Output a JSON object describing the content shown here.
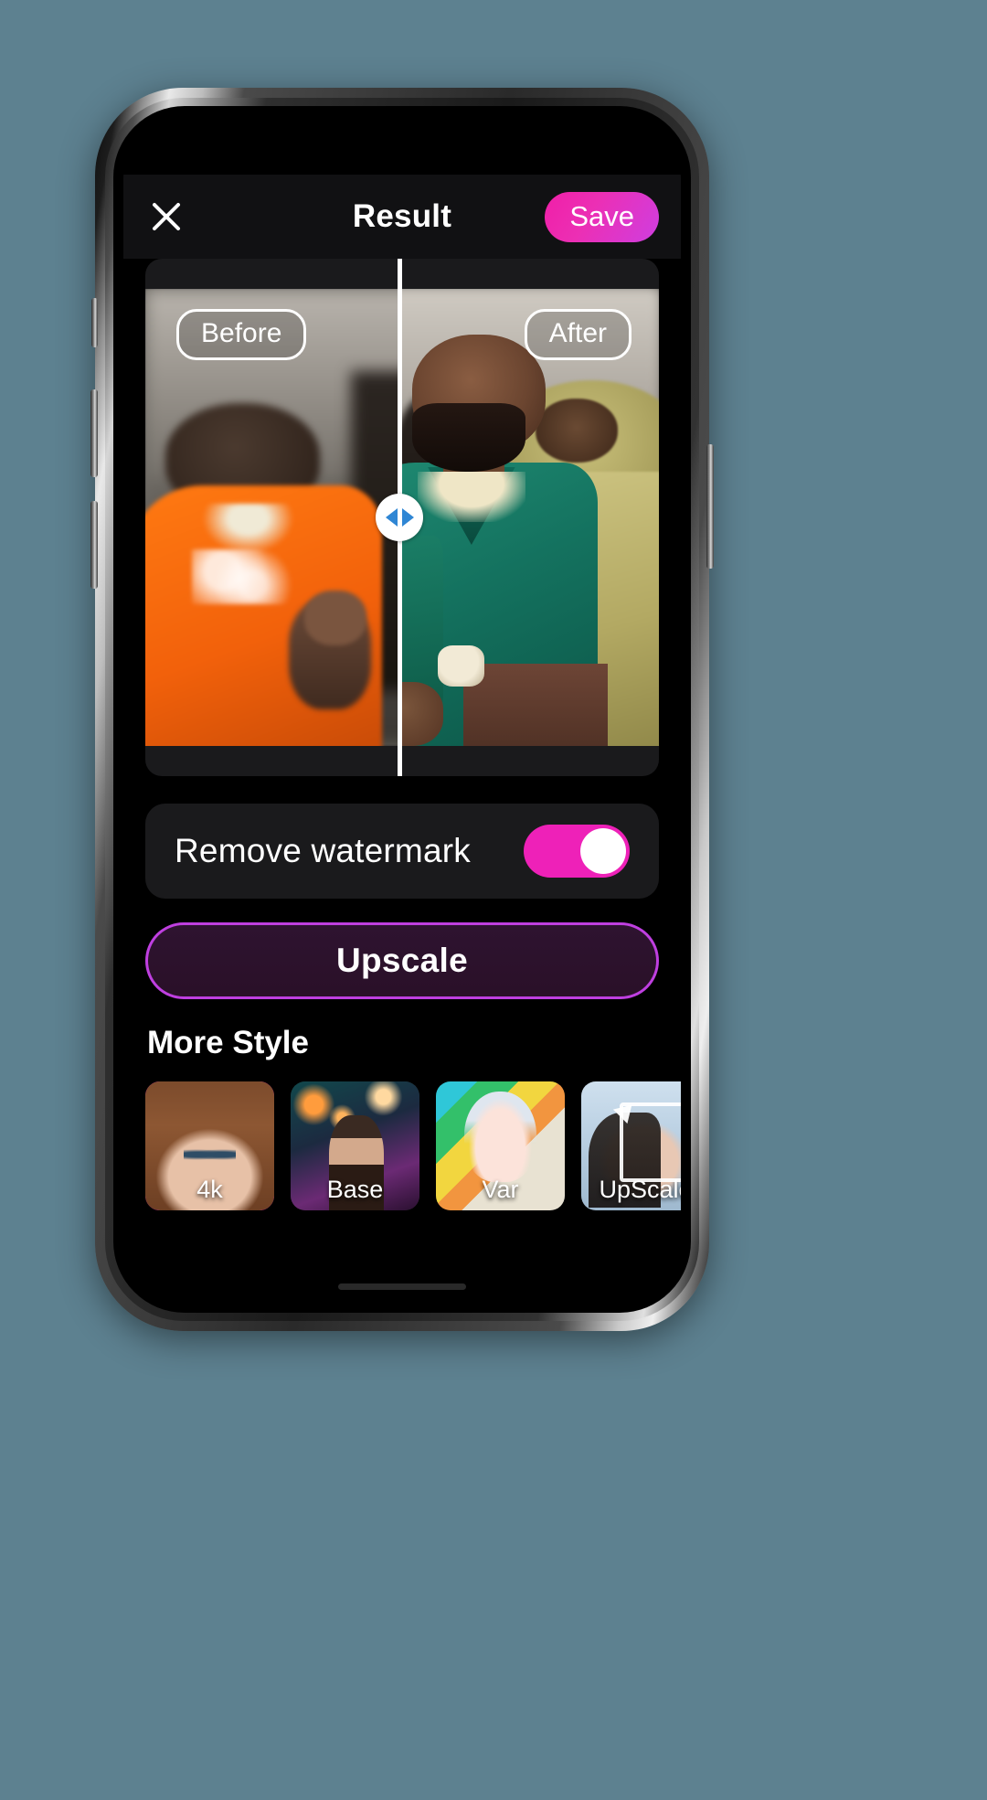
{
  "app": {
    "header": {
      "close_icon": "close-icon",
      "title": "Result",
      "save_label": "Save"
    },
    "compare": {
      "before_label": "Before",
      "after_label": "After",
      "slider_handle_icon": "left-right-arrows-icon",
      "divider_position_percent": 49.5
    },
    "watermark": {
      "label": "Remove watermark",
      "toggle_state": "on"
    },
    "upscale": {
      "label": "Upscale"
    },
    "more_style": {
      "title": "More Style",
      "items": [
        {
          "label": "4k",
          "selected": true
        },
        {
          "label": "Base",
          "selected": false
        },
        {
          "label": "Var",
          "selected": false
        },
        {
          "label": "UpScale",
          "selected": false
        }
      ]
    }
  },
  "colors": {
    "page_background": "#5d8190",
    "screen_background": "#000000",
    "panel": "#1a1a1c",
    "appbar": "#111113",
    "accent_pink": "#ee21b8",
    "accent_purple": "#bf3fe0",
    "save_gradient_from": "#f01fa8",
    "save_gradient_to": "#cf3ee0",
    "slider_arrow": "#2f86d4",
    "text_primary": "#ffffff"
  }
}
